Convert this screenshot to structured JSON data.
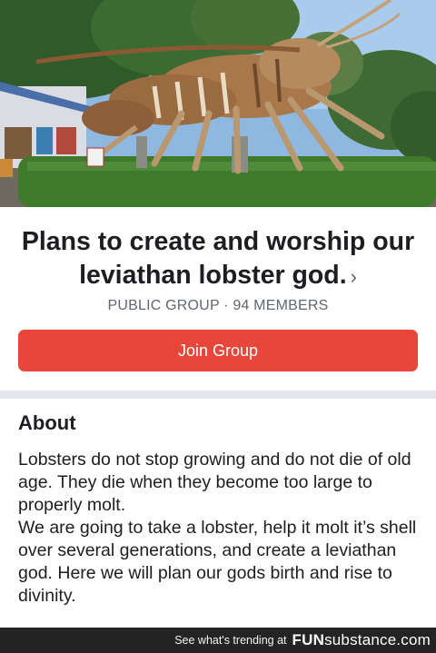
{
  "group": {
    "name": "Plans to create and worship our leviathan lobster god.",
    "chevron": "›",
    "meta": "PUBLIC GROUP · 94 MEMBERS",
    "join_label": "Join Group"
  },
  "about": {
    "heading": "About",
    "paragraph1": "Lobsters do not stop growing and do not die of old age. They die when they become too large to properly molt.",
    "paragraph2": "We are going to take a lobster, help it molt it’s shell over several generations, and create a leviathan god. Here we will plan our gods birth and rise to divinity."
  },
  "watermark": {
    "text": "See what's trending at",
    "brand_bold": "FUN",
    "brand_rest": "substance.com"
  },
  "colors": {
    "join_button": "#e9463b",
    "watermark_bg": "#242424",
    "divider": "#e4e6eb",
    "secondary_text": "#606770"
  }
}
